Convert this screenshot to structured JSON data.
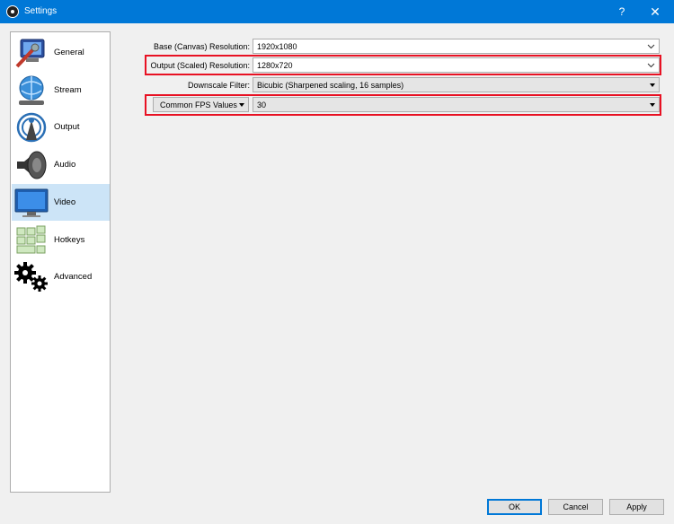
{
  "window": {
    "title": "Settings",
    "help": "?",
    "close": "✕",
    "accent_color": "#0078d7"
  },
  "sidebar": {
    "items": [
      {
        "label": "General",
        "icon": "general-icon"
      },
      {
        "label": "Stream",
        "icon": "stream-icon"
      },
      {
        "label": "Output",
        "icon": "output-icon"
      },
      {
        "label": "Audio",
        "icon": "audio-icon"
      },
      {
        "label": "Video",
        "icon": "video-icon",
        "selected": true
      },
      {
        "label": "Hotkeys",
        "icon": "hotkeys-icon"
      },
      {
        "label": "Advanced",
        "icon": "advanced-icon"
      }
    ]
  },
  "video": {
    "base_resolution": {
      "label": "Base (Canvas) Resolution:",
      "value": "1920x1080"
    },
    "output_resolution": {
      "label": "Output (Scaled) Resolution:",
      "value": "1280x720"
    },
    "downscale_filter": {
      "label": "Downscale Filter:",
      "value": "Bicubic (Sharpened scaling, 16 samples)"
    },
    "fps": {
      "type_label": "Common FPS Values",
      "value": "30"
    }
  },
  "buttons": {
    "ok": "OK",
    "cancel": "Cancel",
    "apply": "Apply"
  },
  "highlight_color": "#e81123"
}
